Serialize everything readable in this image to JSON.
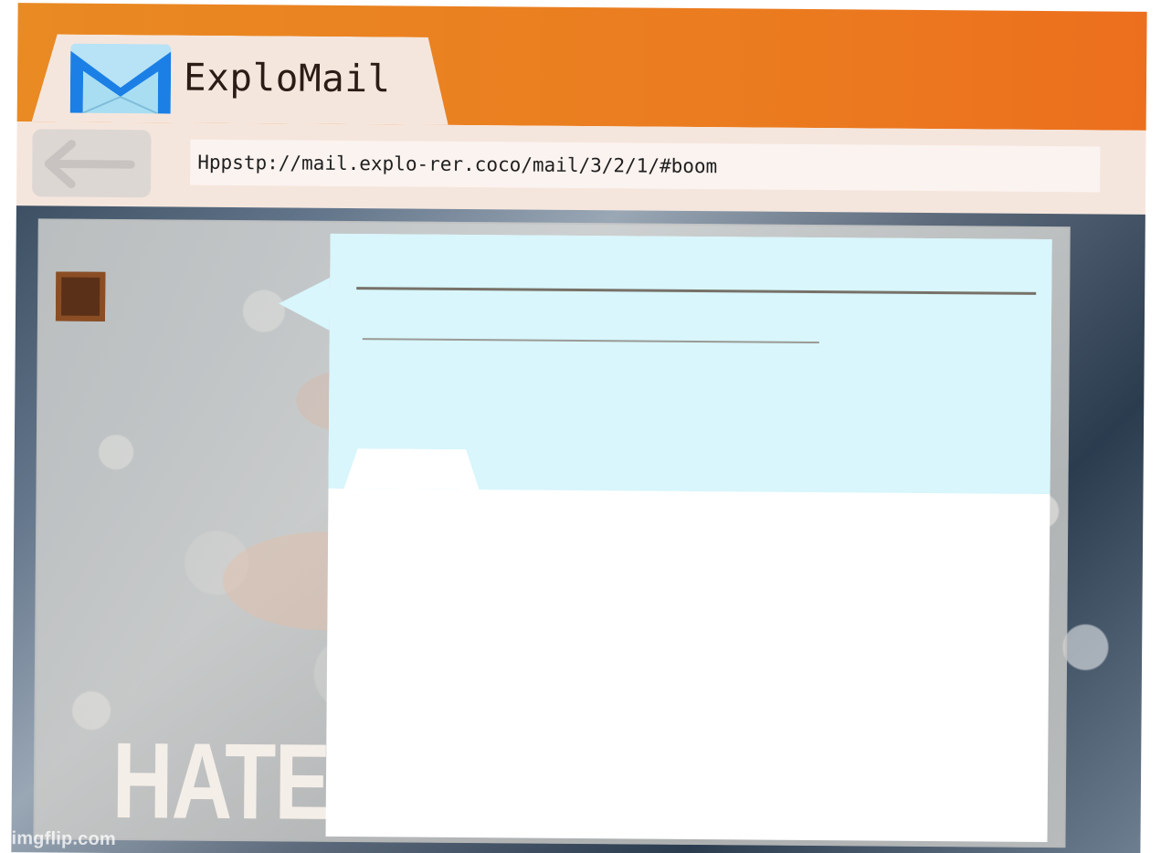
{
  "app": {
    "title": "ExploMail",
    "icon": "envelope-icon",
    "colors": {
      "title_bar": "#EA801F",
      "tab_surface": "#F5E6DD",
      "message_header": "#D8F6FC"
    }
  },
  "toolbar": {
    "back_icon": "back-arrow-icon",
    "url": "Hppstp://mail.explo-rer.coco/mail/3/2/1/#boom"
  },
  "background": {
    "meme_text": "HATE",
    "watermark": "imgflip.com"
  },
  "message": {
    "avatar_icon": "sender-avatar-icon",
    "reply_tab_icon": "reply-tab-icon"
  }
}
